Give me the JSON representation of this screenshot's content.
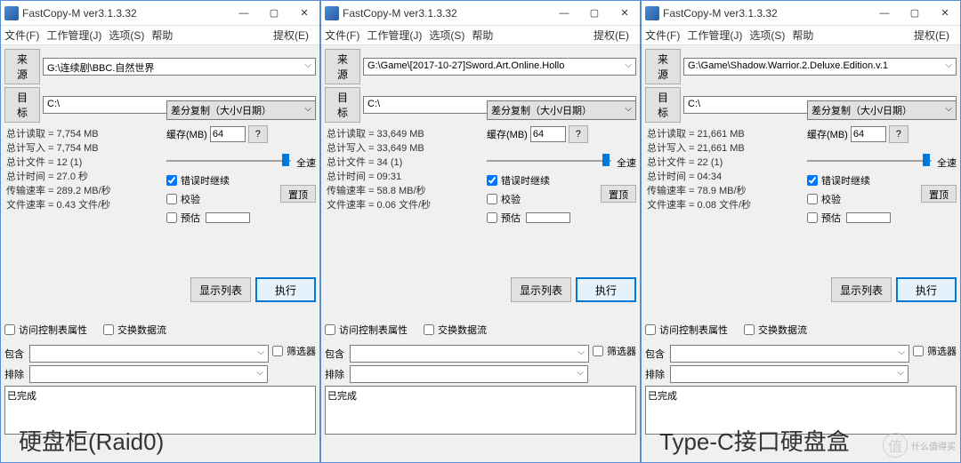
{
  "app_title": "FastCopy-M ver3.1.3.32",
  "menu": {
    "file": "文件(F)",
    "job": "工作管理(J)",
    "option": "选项(S)",
    "help": "帮助",
    "auth": "提权(E)"
  },
  "labels": {
    "source": "来源",
    "dest": "目标",
    "buffer": "缓存(MB)",
    "q": "?",
    "full": "全速",
    "err_continue": "错误时继续",
    "verify": "校验",
    "estimate": "预估",
    "top": "置顶",
    "show_list": "显示列表",
    "execute": "执行",
    "acl": "访问控制表属性",
    "swap": "交换数据流",
    "include": "包含",
    "exclude": "排除",
    "filter": "筛选器",
    "mode": "差分复制（大小/日期）",
    "total_read": "总计读取",
    "total_write": "总计写入",
    "total_files": "总计文件",
    "total_time": "总计时间",
    "rate": "传输速率",
    "file_rate": "文件速率",
    "done": "已完成"
  },
  "buffer_value": "64",
  "windows": [
    {
      "source": "G:\\连续剧\\BBC.自然世界",
      "dest": "C:\\",
      "stats": {
        "read": "7,754 MB",
        "write": "7,754 MB",
        "files": "12 (1)",
        "time": "27.0 秒",
        "rate": "289.2 MB/秒",
        "frate": "0.43 文件/秒"
      },
      "annotation": "硬盘柜(Raid0)"
    },
    {
      "source": "G:\\Game\\[2017-10-27]Sword.Art.Online.Hollo",
      "dest": "C:\\",
      "stats": {
        "read": "33,649 MB",
        "write": "33,649 MB",
        "files": "34 (1)",
        "time": "09:31",
        "rate": "58.8 MB/秒",
        "frate": "0.06 文件/秒"
      },
      "annotation": ""
    },
    {
      "source": "G:\\Game\\Shadow.Warrior.2.Deluxe.Edition.v.1",
      "dest": "C:\\",
      "stats": {
        "read": "21,661 MB",
        "write": "21,661 MB",
        "files": "22 (1)",
        "time": "04:34",
        "rate": "78.9 MB/秒",
        "frate": "0.08 文件/秒"
      },
      "annotation": "Type-C接口硬盘盒"
    }
  ],
  "watermark": "什么值得买"
}
